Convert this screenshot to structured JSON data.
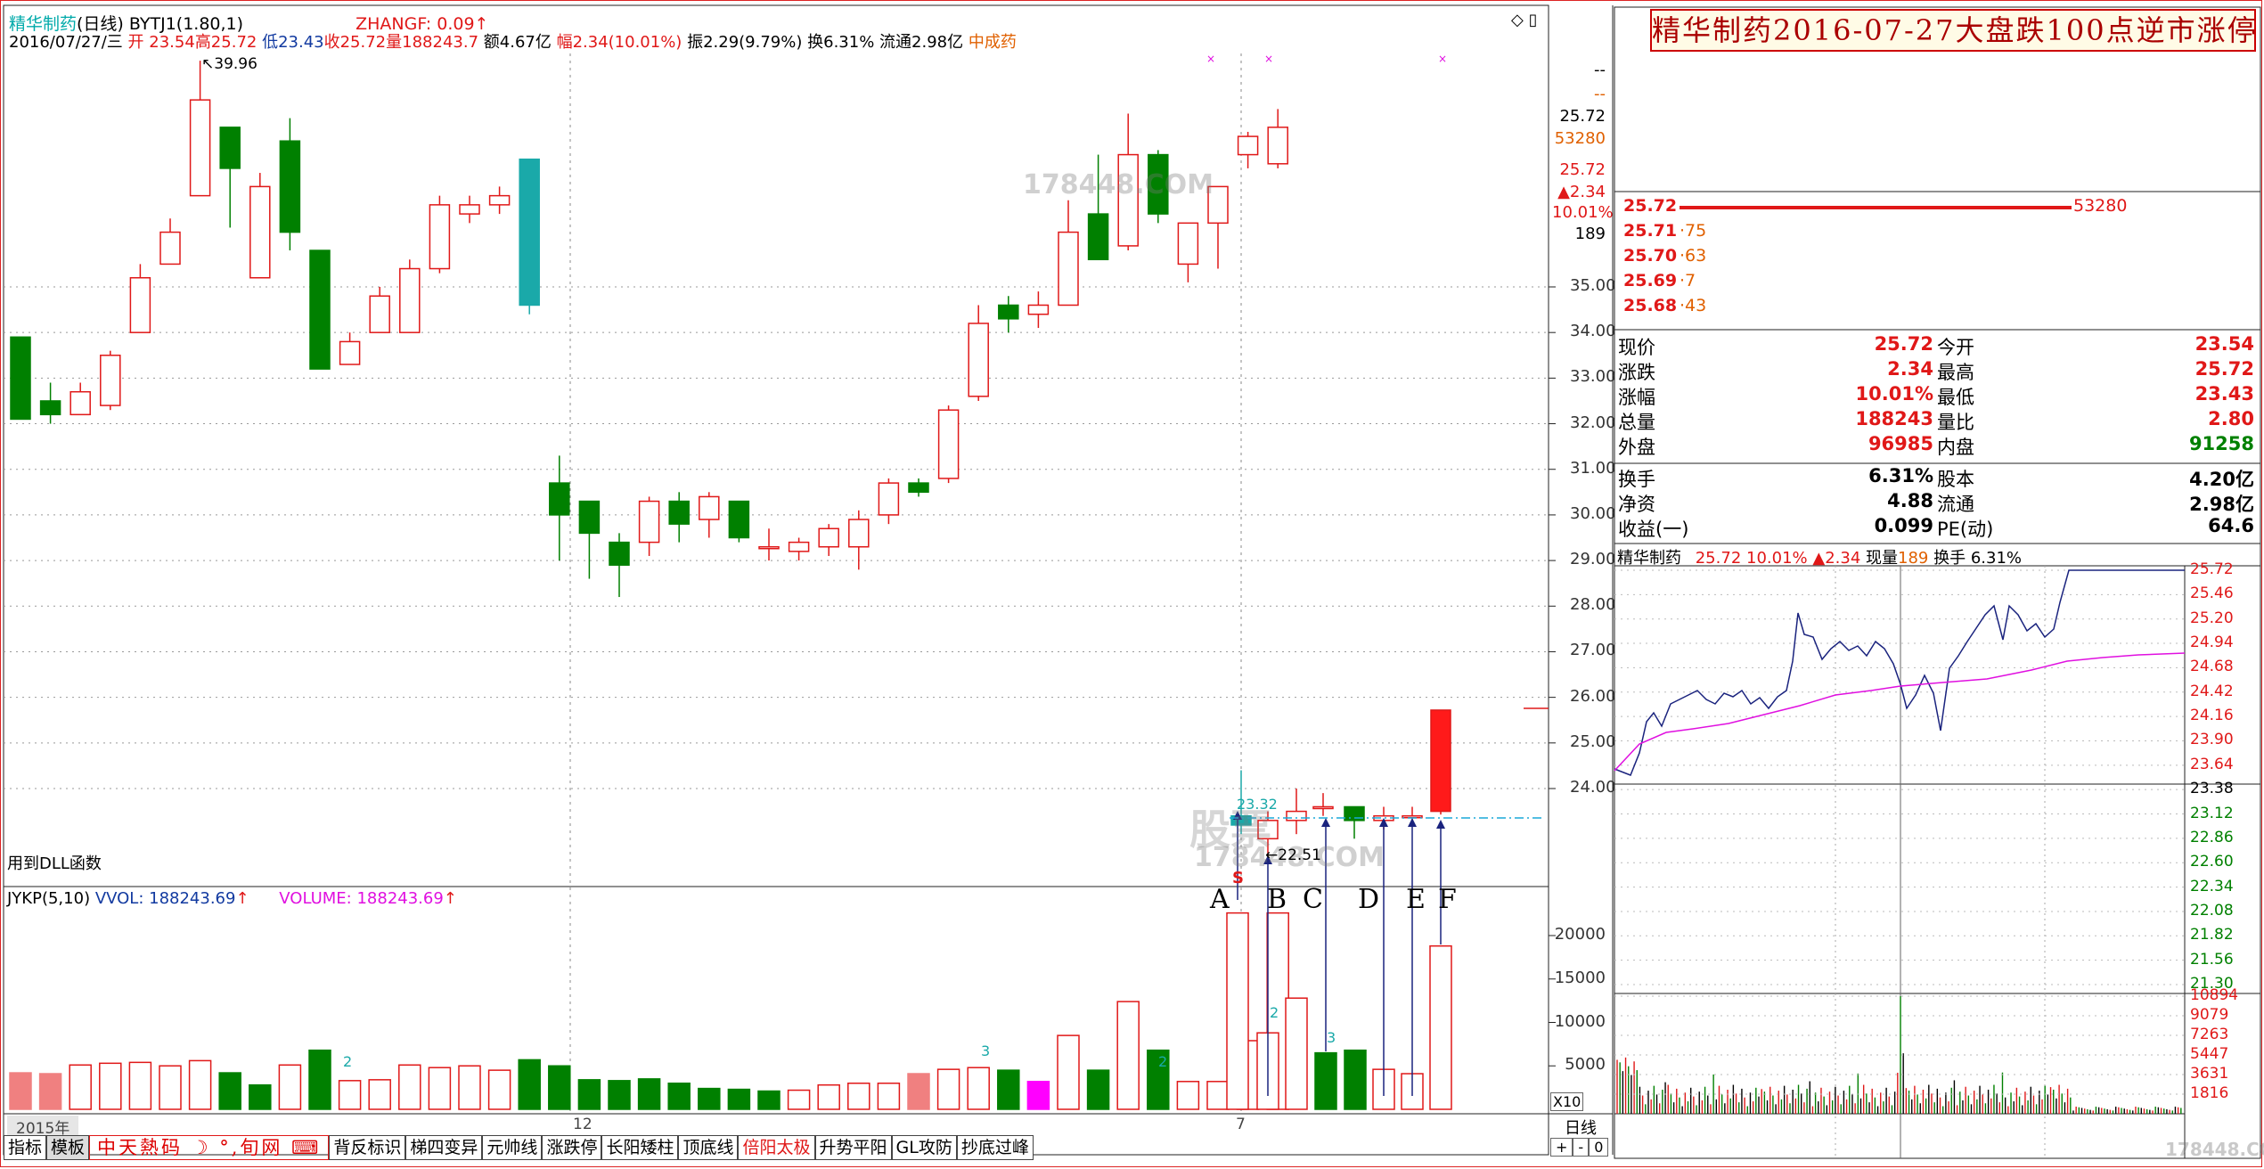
{
  "header": {
    "name": "精华制药",
    "period": "(日线)",
    "indicator": "BYTJ1(1.80,1)",
    "zhangf_label": "ZHANGF: 0.09",
    "zhangf_arrow": "↑",
    "date": "2016/07/27/三",
    "open": "开 23.54",
    "high": "高25.72",
    "low": "低23.43",
    "close": "收25.72",
    "volume": "量188243.7",
    "amount": "额4.67亿",
    "change": "幅2.34(10.01%)",
    "amplitude": "振2.29(9.79%)",
    "turnover": "换6.31%",
    "float": "流通2.98亿",
    "sector": "中成药"
  },
  "main_chart": {
    "high_mark": "39.96",
    "low_mark": "22.51",
    "open_mark": "23.32",
    "price_axis": [
      "35.00",
      "34.00",
      "33.00",
      "32.00",
      "31.00",
      "30.00",
      "29.00",
      "28.00",
      "27.00",
      "26.00",
      "25.00",
      "24.00"
    ],
    "top_axis": [
      "--",
      "--",
      "25.72",
      "53280",
      "25.72",
      "▲2.34",
      "10.01%",
      "189"
    ],
    "dll_note": "用到DLL函数",
    "annot_letters": [
      "A",
      "B",
      "C",
      "D",
      "E",
      "F"
    ],
    "mark_s": "S",
    "mark_2": "2",
    "mark_3": "3",
    "date_marks": [
      "2015年",
      "12",
      "7"
    ],
    "watermark": "178448.COM",
    "watermark2": "股票"
  },
  "volume_panel": {
    "title": "JYKP(5,10)",
    "vvol": "VVOL: 188243.69",
    "volume": "VOLUME: 188243.69",
    "axis": [
      "20000",
      "15000",
      "10000",
      "5000"
    ],
    "x10": "X10",
    "labels_2": "2",
    "labels_3": "3"
  },
  "bottom_tabs": {
    "items": [
      "指标",
      "模板",
      "背反标识",
      "梯四变异",
      "元帅线",
      "涨跌停",
      "长阳矮柱",
      "顶底线",
      "倍阳太极",
      "升势平阳",
      "GL攻防",
      "抄底过峰"
    ],
    "logo": "中天熱码",
    "logo_suffix": "旬网",
    "period_btn": "日线",
    "zoom": [
      "+",
      "-",
      "0"
    ]
  },
  "right_panel": {
    "title": "精华制药2016-07-27大盘跌100点逆市涨停",
    "sell_rows": [
      {
        "price": "25.72",
        "qty": "53280"
      },
      {
        "price": "25.71",
        "qty": "75"
      },
      {
        "price": "25.70",
        "qty": "63"
      },
      {
        "price": "25.69",
        "qty": "7"
      },
      {
        "price": "25.68",
        "qty": "43"
      }
    ],
    "quote": [
      {
        "l": "现价",
        "v": "25.72",
        "l2": "今开",
        "v2": "23.54"
      },
      {
        "l": "涨跌",
        "v": "2.34",
        "l2": "最高",
        "v2": "25.72"
      },
      {
        "l": "涨幅",
        "v": "10.01%",
        "l2": "最低",
        "v2": "23.43"
      },
      {
        "l": "总量",
        "v": "188243",
        "l2": "量比",
        "v2": "2.80"
      },
      {
        "l": "外盘",
        "v": "96985",
        "l2": "内盘",
        "v2": "91258"
      }
    ],
    "quote2": [
      {
        "l": "换手",
        "v": "6.31%",
        "l2": "股本",
        "v2": "4.20亿"
      },
      {
        "l": "净资",
        "v": "4.88",
        "l2": "流通",
        "v2": "2.98亿"
      },
      {
        "l": "收益(一)",
        "v": "0.099",
        "l2": "PE(动)",
        "v2": "64.6"
      }
    ],
    "intraday_title": "精华制药",
    "intraday_price": "25.72",
    "intraday_pct": "10.01%",
    "intraday_chg": "▲2.34",
    "intraday_vol_label": "现量",
    "intraday_vol": "189",
    "intraday_turn": "换手 6.31%",
    "price_axis": [
      "25.72",
      "25.46",
      "25.20",
      "24.94",
      "24.68",
      "24.42",
      "24.16",
      "23.90",
      "23.64",
      "23.38",
      "23.12",
      "22.86",
      "22.60",
      "22.34",
      "22.08",
      "21.82",
      "21.56",
      "21.30"
    ],
    "vol_axis": [
      "10894",
      "9079",
      "7263",
      "5447",
      "3631",
      "1816"
    ],
    "watermark": "178448.COM"
  },
  "colors": {
    "up": "#e01818",
    "down": "#008000",
    "frame": "#d22",
    "teal": "#1aa9a9",
    "avg": "#e010e0",
    "line": "#1a237e"
  }
}
